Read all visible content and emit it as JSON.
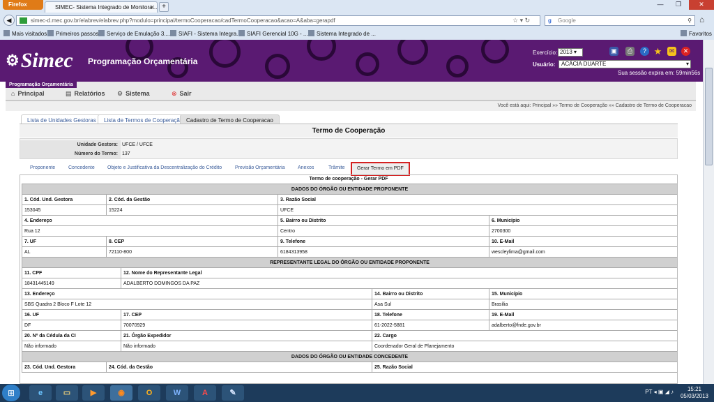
{
  "browser": {
    "app_button": "Firefox",
    "tab_title": "SIMEC- Sistema Integrado de Monitora...",
    "url": "simec-d.mec.gov.br/elabrev/elabrev.php?modulo=principal/termoCooperacao/cadTermoCooperacao&acao=A&aba=gerapdf",
    "search_placeholder": "Google",
    "bookmarks": [
      "Mais visitados",
      "Primeiros passos",
      "Serviço de Emulação 3....",
      "SIAFI - Sistema Integra...",
      "SIAFI Gerencial 10G - ...",
      "Sistema Integrado de ..."
    ],
    "favoritos": "Favoritos"
  },
  "header": {
    "logo": "Simec",
    "title": "Programação Orçamentária",
    "exercicio_label": "Exercício:",
    "exercicio_value": "2013",
    "usuario_label": "Usuário:",
    "usuario_value": "ACÁCIA DUARTE",
    "session": "Sua sessão expira em: 59min56s"
  },
  "menu": {
    "module_tag": "Programação Orçamentária",
    "items": [
      "Principal",
      "Relatórios",
      "Sistema",
      "Sair"
    ]
  },
  "breadcrumb": "Você está aqui: Principal »» Termo de Cooperação »» Cadastro de Termo de Cooperacao",
  "tabs_top": [
    "Lista de Unidades Gestoras",
    "Lista de Termos de Cooperação",
    "Cadastro de Termo de Cooperacao"
  ],
  "page_title": "Termo de Cooperação",
  "info": {
    "ug_label": "Unidade Gestora:",
    "ug_value": "UFCE / UFCE",
    "num_label": "Número do Termo:",
    "num_value": "137"
  },
  "tabs_sub": [
    "Proponente",
    "Concedente",
    "Objeto e Justificativa da Descentralização do Crédito",
    "Previsão Orçamentária",
    "Anexos",
    "Trâmite",
    "Gerar Termo em PDF"
  ],
  "doc": {
    "title": "Termo de cooperação - Gerar PDF",
    "sec1": "DADOS DO ÓRGÃO OU ENTIDADE PROPONENTE",
    "l1": "1. Cód. Und. Gestora",
    "v1": "153045",
    "l2": "2. Cód. da Gestão",
    "v2": "15224",
    "l3": "3. Razão Social",
    "v3": "UFCE",
    "l4": "4. Endereço",
    "v4": "Rua 12",
    "l5": "5. Bairro ou Distrito",
    "v5": "Centro",
    "l6": "6. Município",
    "v6": "2700300",
    "l7": "7. UF",
    "v7": "AL",
    "l8": "8. CEP",
    "v8": "72110-800",
    "l9": "9. Telefone",
    "v9": "6184313958",
    "l10": "10. E-Mail",
    "v10": "wescleylima@gmail.com",
    "sec2": "REPRESENTANTE LEGAL DO ÓRGÃO OU ENTIDADE PROPONENTE",
    "l11": "11. CPF",
    "v11": "18431445149",
    "l12": "12. Nome do Representante Legal",
    "v12": "ADALBERTO DOMINGOS DA PAZ",
    "l13": "13. Endereço",
    "v13": "SBS Quadra 2 Bloco F Lote 12",
    "l14": "14. Bairro ou Distrito",
    "v14": "Asa Sul",
    "l15": "15. Município",
    "v15": "Brasília",
    "l16": "16. UF",
    "v16": "DF",
    "l17": "17. CEP",
    "v17": "70070929",
    "l18": "18. Telefone",
    "v18": "61-2022-5881",
    "l19": "19. E-Mail",
    "v19": "adalberto@fnde.gov.br",
    "l20": "20. Nº da Cédula da CI",
    "v20": "Não informado",
    "l21": "21. Órgão Expedidor",
    "v21": "Não informado",
    "l22": "22. Cargo",
    "v22": "Coordenador Geral de Planejamento",
    "sec3": "DADOS DO ÓRGÃO OU ENTIDADE CONCEDENTE",
    "l23": "23. Cód. Und. Gestora",
    "l24": "24. Cód. da Gestão",
    "l25": "25. Razão Social"
  },
  "taskbar": {
    "lang": "PT",
    "time": "15:21",
    "date": "05/03/2013"
  }
}
